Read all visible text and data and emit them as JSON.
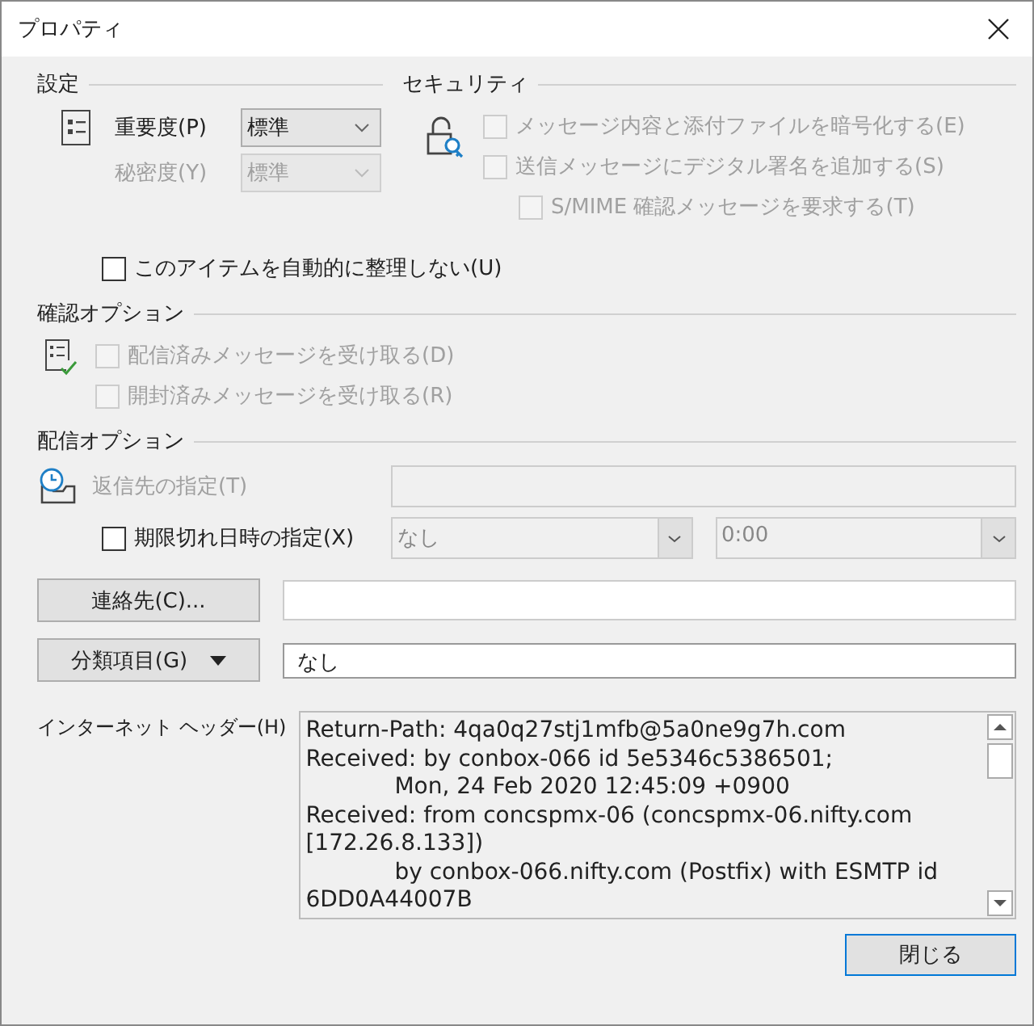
{
  "window": {
    "title": "プロパティ"
  },
  "settings": {
    "heading": "設定",
    "combos": [
      {
        "label": "重要度(P)",
        "value": "標準",
        "disabled": false
      },
      {
        "label": "秘密度(Y)",
        "value": "標準",
        "disabled": true
      }
    ],
    "no_autoarchive": {
      "label": "このアイテムを自動的に整理しない(U)",
      "checked": false,
      "disabled": false
    }
  },
  "security": {
    "heading": "セキュリティ",
    "options": [
      {
        "label": "メッセージ内容と添付ファイルを暗号化する(E)",
        "checked": false,
        "disabled": true
      },
      {
        "label": "送信メッセージにデジタル署名を追加する(S)",
        "checked": false,
        "disabled": true,
        "children": [
          {
            "label": "S/MIME 確認メッセージを要求する(T)",
            "checked": false,
            "disabled": true
          }
        ]
      }
    ]
  },
  "tracking": {
    "heading": "確認オプション",
    "options": [
      {
        "label": "配信済みメッセージを受け取る(D)",
        "checked": false,
        "disabled": true
      },
      {
        "label": "開封済みメッセージを受け取る(R)",
        "checked": false,
        "disabled": true
      }
    ]
  },
  "delivery": {
    "heading": "配信オプション",
    "reply_to": {
      "label": "返信先の指定(T)",
      "disabled": true
    },
    "expires": {
      "label": "期限切れ日時の指定(X)",
      "checked": false,
      "disabled": false,
      "date": "なし",
      "time": "0:00",
      "fields_disabled": true
    }
  },
  "contacts": {
    "button": "連絡先(C)..."
  },
  "categories": {
    "button": "分類項目(G)",
    "value": "なし"
  },
  "headers": {
    "label": "インターネット ヘッダー(H)",
    "lines": [
      {
        "text": "Return-Path: 4qa0q27stj1mfb@5a0ne9g7h.com",
        "indent": false
      },
      {
        "text": "Received: by conbox-066 id 5e5346c5386501;",
        "indent": false
      },
      {
        "text": "Mon, 24 Feb 2020 12:45:09 +0900",
        "indent": true
      },
      {
        "text": "Received: from concspmx-06 (concspmx-06.nifty.com",
        "indent": false
      },
      {
        "text": "[172.26.8.133])",
        "indent": false
      },
      {
        "text": "by conbox-066.nifty.com (Postfix) with ESMTP id",
        "indent": true
      },
      {
        "text": "6DD0A44007B",
        "indent": false
      }
    ]
  },
  "close_button": "閉じる"
}
